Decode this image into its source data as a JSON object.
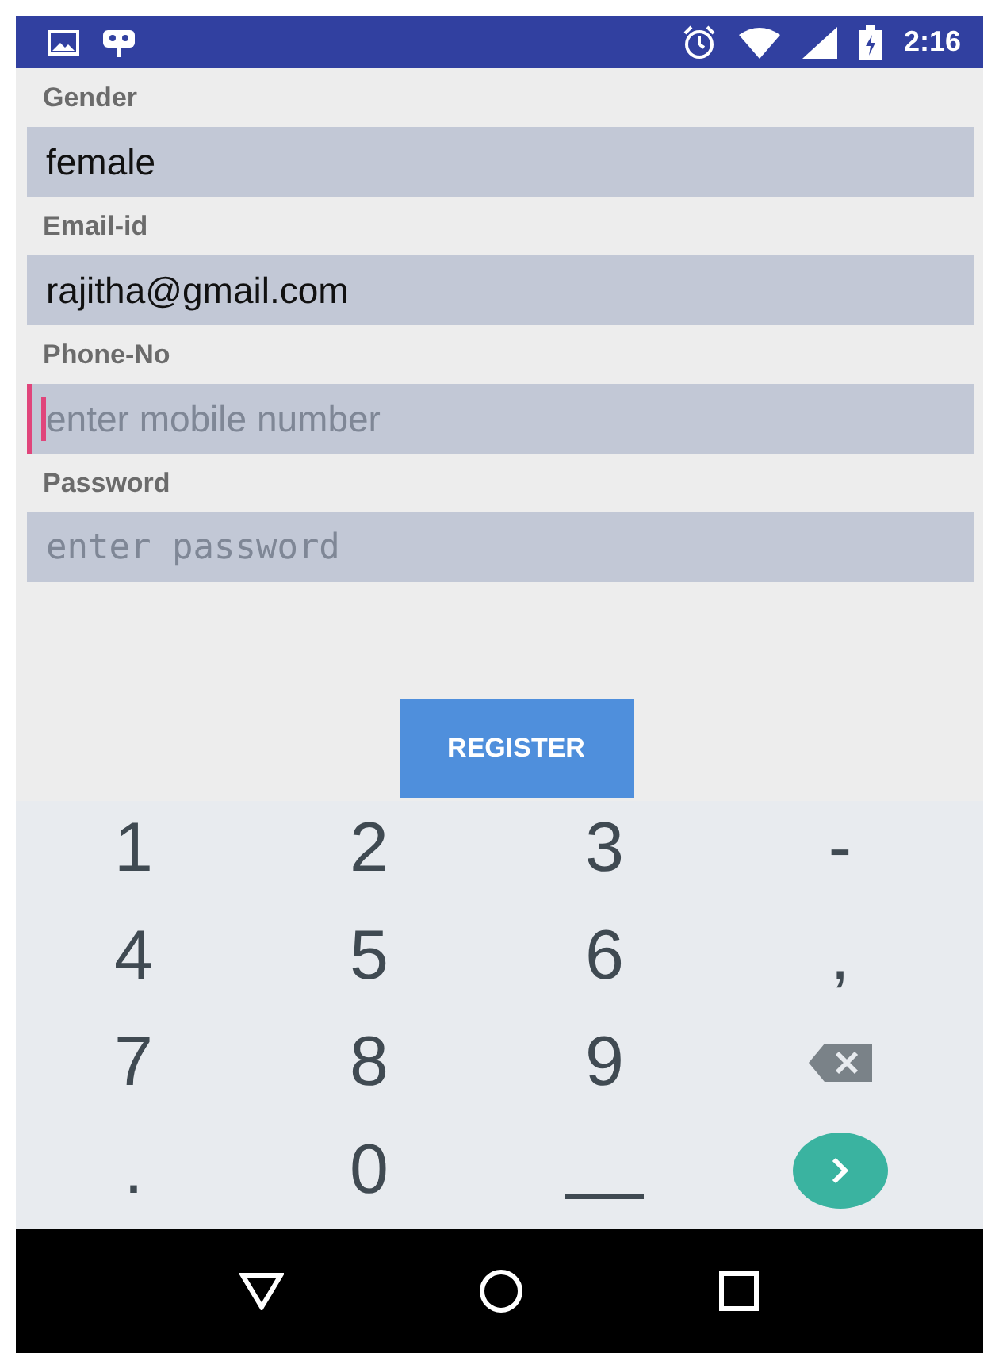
{
  "status_bar": {
    "time": "2:16"
  },
  "fields": [
    {
      "label": "Gender",
      "value": "female",
      "kind": "text",
      "focused": false
    },
    {
      "label": "Email-id",
      "value": "rajitha@gmail.com",
      "kind": "text",
      "focused": false
    },
    {
      "label": "Phone-No",
      "placeholder": "enter mobile number",
      "kind": "text",
      "focused": true
    },
    {
      "label": "Password",
      "placeholder": "enter password",
      "kind": "password",
      "focused": false
    }
  ],
  "register_button": "REGISTER",
  "keyboard": [
    {
      "kind": "char",
      "label": "1"
    },
    {
      "kind": "char",
      "label": "2"
    },
    {
      "kind": "char",
      "label": "3"
    },
    {
      "kind": "char",
      "label": "-"
    },
    {
      "kind": "char",
      "label": "4"
    },
    {
      "kind": "char",
      "label": "5"
    },
    {
      "kind": "char",
      "label": "6"
    },
    {
      "kind": "char",
      "label": ","
    },
    {
      "kind": "char",
      "label": "7"
    },
    {
      "kind": "char",
      "label": "8"
    },
    {
      "kind": "char",
      "label": "9"
    },
    {
      "kind": "backspace"
    },
    {
      "kind": "char",
      "label": "."
    },
    {
      "kind": "char",
      "label": "0"
    },
    {
      "kind": "space"
    },
    {
      "kind": "enter"
    }
  ]
}
